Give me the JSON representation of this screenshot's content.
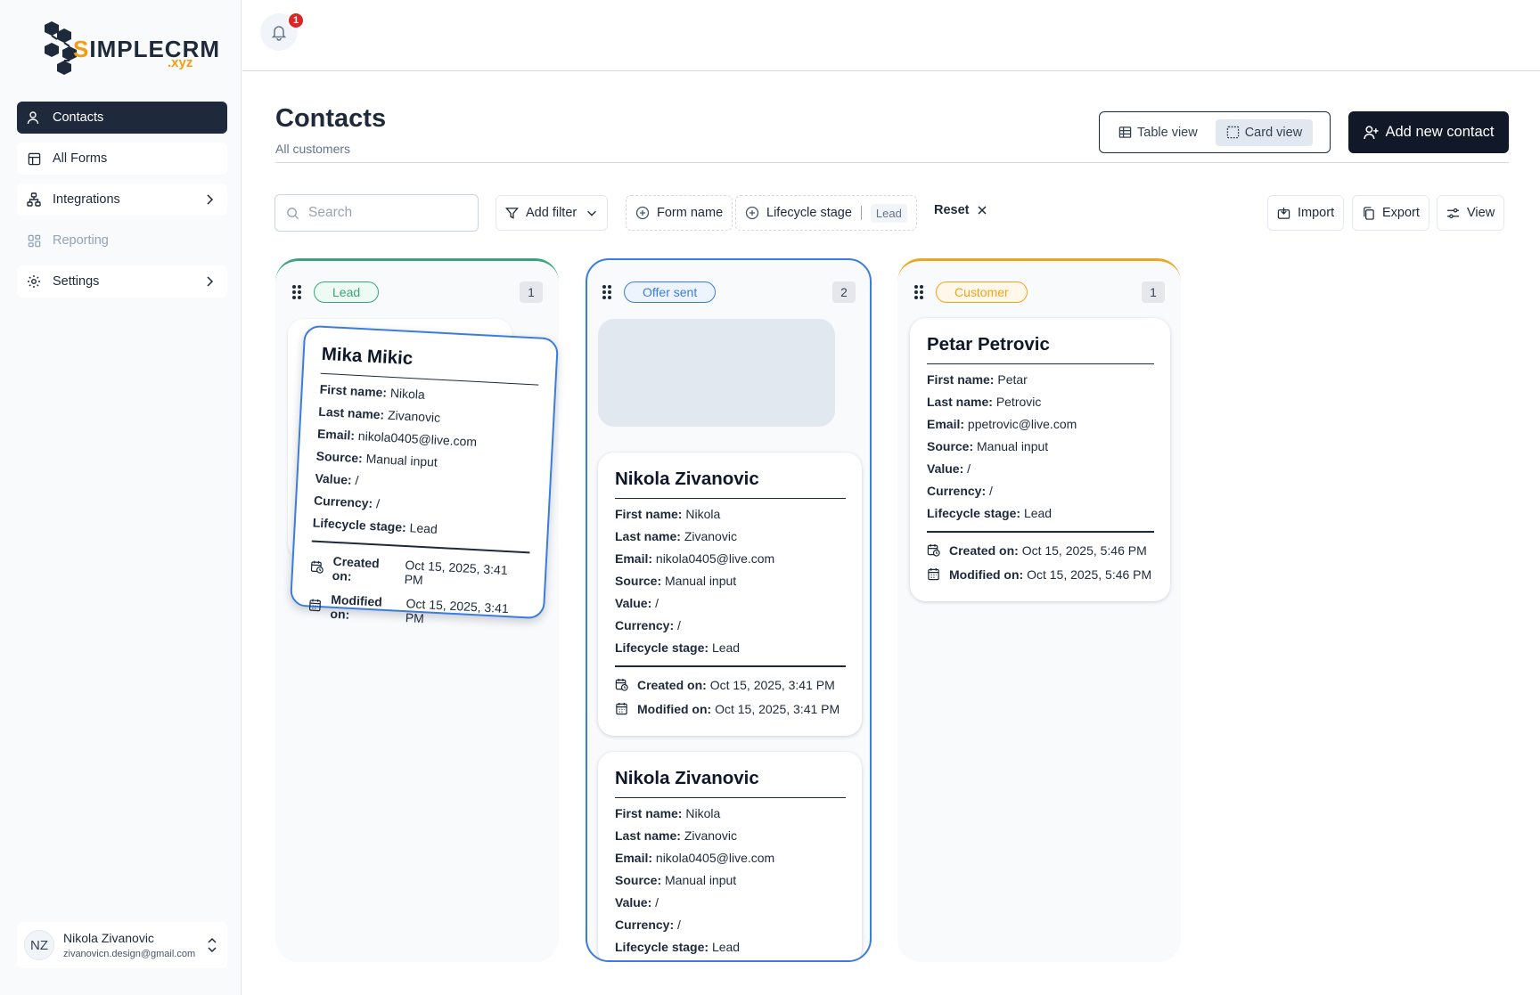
{
  "brand": {
    "logo_prefix": "S",
    "logo_main": "IMPLE",
    "logo_crm": "CRM",
    "logo_suffix": ".xyz"
  },
  "sidebar": {
    "items": [
      {
        "label": "Contacts",
        "icon": "user-icon",
        "active": true
      },
      {
        "label": "All Forms",
        "icon": "table-icon"
      },
      {
        "label": "Integrations",
        "icon": "network-icon",
        "has_chevron": true
      },
      {
        "label": "Reporting",
        "icon": "dashboard-icon",
        "disabled": true
      },
      {
        "label": "Settings",
        "icon": "gear-icon",
        "has_chevron": true
      }
    ],
    "user": {
      "initials": "NZ",
      "name": "Nikola Zivanovic",
      "email": "zivanovicn.design@gmail.com"
    }
  },
  "header": {
    "notification_count": "1"
  },
  "page": {
    "title": "Contacts",
    "subtitle": "All customers",
    "view_switch": {
      "table_label": "Table view",
      "card_label": "Card view",
      "selected": "Card view"
    },
    "add_button_label": "Add new contact"
  },
  "toolbar": {
    "search_placeholder": "Search",
    "add_filter_label": "Add filter",
    "form_name_label": "Form name",
    "lifecycle_label": "Lifecycle stage",
    "lifecycle_value": "Lead",
    "reset_label": "Reset",
    "import_label": "Import",
    "export_label": "Export",
    "view_label": "View"
  },
  "labels": {
    "first_name": "First name:",
    "last_name": "Last name:",
    "email": "Email:",
    "source": "Source:",
    "value": "Value:",
    "currency": "Currency:",
    "lifecycle": "Lifecycle stage:",
    "created": "Created on:",
    "modified": "Modified on:"
  },
  "colors": {
    "lead": "#3aa37a",
    "offer": "#3b7ddd",
    "customer": "#f0a419",
    "primary": "#1e293b"
  },
  "columns": [
    {
      "stage": "Lead",
      "count": "1",
      "cards": [
        {
          "name": "Mika Mikic",
          "first_name": "Nikola",
          "last_name": "Zivanovic",
          "email": "nikola0405@live.com",
          "source": "Manual input",
          "value": "/",
          "currency": "/",
          "lifecycle": "Lead",
          "created": "Oct 15, 2025, 3:41 PM",
          "modified": "Oct 15, 2025, 3:41 PM",
          "dragging": true
        }
      ]
    },
    {
      "stage": "Offer sent",
      "count": "2",
      "cards": [
        {
          "name": "Nikola Zivanovic",
          "first_name": "Nikola",
          "last_name": "Zivanovic",
          "email": "nikola0405@live.com",
          "source": "Manual input",
          "value": "/",
          "currency": "/",
          "lifecycle": "Lead",
          "created": "Oct 15, 2025, 3:41 PM",
          "modified": "Oct 15, 2025, 3:41 PM"
        },
        {
          "name": "Nikola Zivanovic",
          "first_name": "Nikola",
          "last_name": "Zivanovic",
          "email": "nikola0405@live.com",
          "source": "Manual input",
          "value": "/",
          "currency": "/",
          "lifecycle": "Lead"
        }
      ]
    },
    {
      "stage": "Customer",
      "count": "1",
      "cards": [
        {
          "name": "Petar Petrovic",
          "first_name": "Petar",
          "last_name": "Petrovic",
          "email": "ppetrovic@live.com",
          "source": "Manual input",
          "value": "/",
          "currency": "/",
          "lifecycle": "Lead",
          "created": "Oct 15, 2025, 5:46 PM",
          "modified": "Oct 15, 2025, 5:46 PM"
        }
      ]
    }
  ]
}
